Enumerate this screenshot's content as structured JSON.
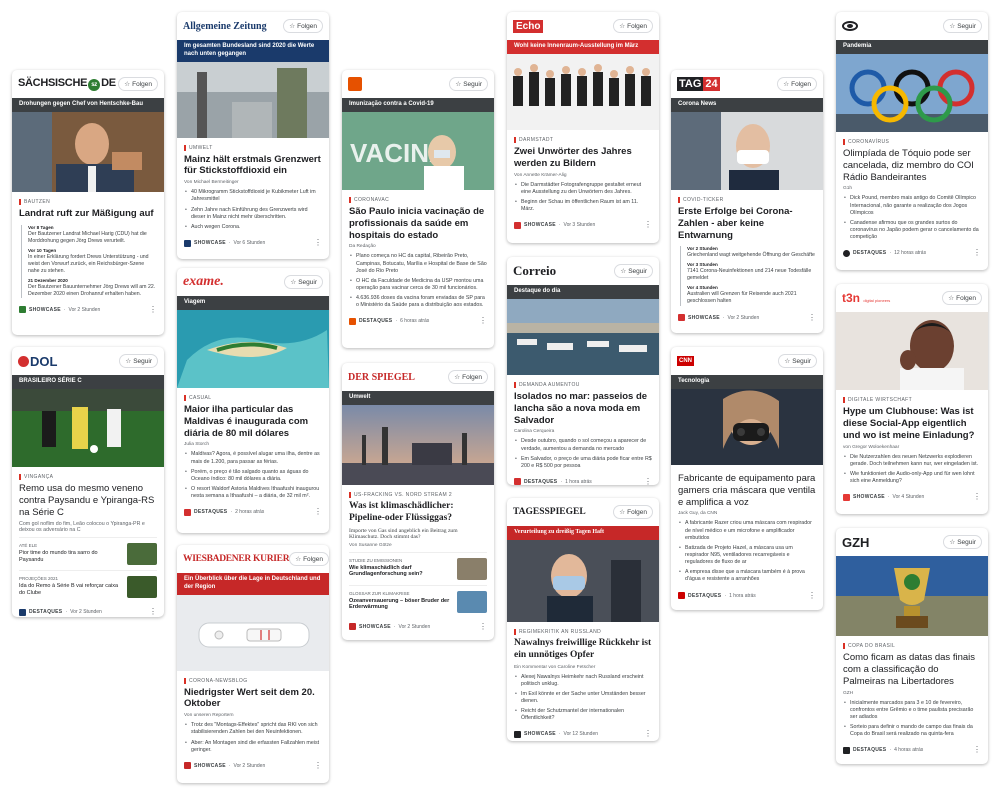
{
  "actions": {
    "follow": "Folgen",
    "seguir": "Seguir"
  },
  "cards": {
    "sz": {
      "logo": "SÄCHSISCHE",
      "logo2": "DE",
      "band": "Drohungen gegen Chef von Hentschke-Bau",
      "kicker": "BAUTZEN",
      "title": "Landrat ruft zur Mäßigung auf",
      "timeline": [
        {
          "t": "Vor 8 Tagen",
          "x": "Der Bautzener Landrat Michael Harig (CDU) hat die Morddrohung gegen Jörg Drews verurteilt."
        },
        {
          "t": "Vor 10 Tagen",
          "x": "In einer Erklärung fordert Drews Unterstützung - und weist den Vorwurf zurück, ein Reichsbürger-Szene nahe zu stehen."
        },
        {
          "t": "21 Dezember 2020",
          "x": "Der Bautzener Bauunternehmer Jörg Drews will am 22. Dezember 2020 einen Drohanruf erhalten haben."
        }
      ],
      "source": "SHOWCASE",
      "time": "Vor 2 Stunden"
    },
    "dol": {
      "logo": "DOL",
      "band": "BRASILEIRO SÉRIE C",
      "kicker": "VINGANÇA",
      "title": "Remo usa do mesmo veneno contra Paysandu e Ypiranga-RS na Série C",
      "desc": "Com gol noflim do fim, Leão colocou o Ypiranga-PR e deixou os adversário na C",
      "related": [
        {
          "k": "ATÉ ELE",
          "h": "Pior time do mundo tira sarro do Paysandu"
        },
        {
          "k": "PROJEÇÕES 2021",
          "h": "Ida do Remo à Série B vai reforçar caixa do Clube"
        }
      ],
      "source": "DESTAQUES",
      "time": "Vor 2 Stunden"
    },
    "az": {
      "logo": "Allgemeine Zeitung",
      "band": "Im gesamten Bundesland sind 2020 die Werte nach unten gegangen",
      "kicker": "UMWELT",
      "title": "Mainz hält erstmals Grenzwert für Stickstoffdioxid ein",
      "byline": "Von Michael Bermeitinger",
      "bullets": [
        "40 Mikrogramm Stickstoffdioxid je Kubikmeter Luft im Jahresmittel",
        "Zehn Jahre nach Einführung des Grenzwerts wird dieser in Mainz nicht mehr überschritten.",
        "Auch wegen Corona."
      ],
      "source": "SHOWCASE",
      "time": "Vor 6 Stunden"
    },
    "exame": {
      "logo": "exame.",
      "band": "Viagem",
      "kicker": "CASUAL",
      "title": "Maior ilha particular das Maldivas é inaugurada com diária de 80 mil dólares",
      "byline": "Julia Storch",
      "bullets": [
        "Maldivas? Agora, é possível alugar uma ilha, dentre as mais de 1.200, para passar as férias.",
        "Porém, o preço é tão salgado quanto as águas do Oceano índico: 80 mil dólares a diária.",
        "O resort Waldorf Astoria Maldives Ithaafushi inaugurou nesta semana a Ithaafushi – a diária, de 32 mil m²."
      ],
      "source": "DESTAQUES",
      "time": "2 horas atrás"
    },
    "wk": {
      "logo": "WIESBADENER KURIER",
      "band": "Ein Überblick über die Lage in Deutschland und der Region",
      "kicker": "CORONA-NEWSBLOG",
      "title": "Niedrigster Wert seit dem 20. Oktober",
      "byline": "Von unseren Reportern",
      "bullets": [
        "Trotz des \"Montags-Effektes\" spricht das RKI von sich stabilisierenden Zahlen bei den Neuinfektionen.",
        "Aber: An Montagen sind die erfassten Fallzahlen meist geringer."
      ],
      "source": "SHOWCASE",
      "time": "Vor 2 Stunden"
    },
    "estadao": {
      "band": "Imunização contra a Covid-19",
      "kicker": "CORONAVAC",
      "title": "São Paulo inicia vacinação de profissionais da saúde em hospitais do estado",
      "byline": "Da Redação",
      "bullets": [
        "Plano começa no HC da capital, Ribeirão Preto, Campinas, Botucatu, Marília e Hospital de Base de São José do Rio Preto",
        "O HC da Faculdade de Medicina da USP montou uma operação para vacinar cerca de 30 mil funcionários.",
        "4.636.936 doses da vacina foram enviadas de SP para o Ministério da Saúde para a distribuição aos estados."
      ],
      "source": "DESTAQUES",
      "time": "6 horas atrás"
    },
    "spiegel": {
      "logo": "DER SPIEGEL",
      "band": "Umwelt",
      "kicker": "US-FRACKING VS. NORD STREAM 2",
      "title": "Was ist klimaschädlicher: Pipeline-oder Flüssiggas?",
      "desc": "Importe von Gas sind angeblich ein Beitrag zum Klimaschutz. Doch stimmt das?",
      "byline": "Von Susanne Götze",
      "related": [
        {
          "k": "STUDIE ZU EMISSIONEN",
          "h": "Wie klimaschädlich darf Grundlagenforschung sein?"
        },
        {
          "k": "GLOSSAR ZUR KLIMAKRISE",
          "h": "Ozeanversauerung – böser Bruder der Erderwärmung"
        }
      ],
      "source": "SHOWCASE",
      "time": "Vor 2 Stunden"
    },
    "echo": {
      "logo": "Echo",
      "band": "Wohl keine Innenraum-Ausstellung im März",
      "kicker": "DARMSTADT",
      "title": "Zwei Unwörter des Jahres werden zu Bildern",
      "byline": "Von Annette Krämer-Alig",
      "bullets": [
        "Die Darmstädter Fotografengruppe gestaltet erneut eine Ausstellung zu den Unwörtern des Jahres.",
        "Beginn der Schau im öffentlichen Raum ist am 11. März."
      ],
      "source": "SHOWCASE",
      "time": "Vor 3 Stunden"
    },
    "correio": {
      "logo": "Correio",
      "band": "Destaque do dia",
      "kicker": "DEMANDA AUMENTOU",
      "title": "Isolados no mar: passeios de lancha são a nova moda em Salvador",
      "byline": "Carolina Cerqueira",
      "bullets": [
        "Desde outubro, quando o sol começou a aparecer de verdade, aumentou a demanda no mercado",
        "Em Salvador, o preço de uma diária pode ficar entre R$ 200 e R$ 500 por pessoa"
      ],
      "source": "DESTAQUES",
      "time": "1 hora atrás"
    },
    "tsp": {
      "logo": "TAGESSPIEGEL",
      "band": "Verurteilung zu dreißig Tagen Haft",
      "kicker": "REGIMEKRITIK AN RUSSLAND",
      "title": "Nawalnys freiwillige Rückkehr ist ein unnötiges Opfer",
      "byline": "Ein Kommentar von Caroline Fetscher",
      "bullets": [
        "Alexej Nawalnys Heimkehr nach Russland erscheint politisch unklug.",
        "Im Exil könnte er der Sache unter Umständen besser dienen.",
        "Reicht der Schutzmantel der internationalen Öffentlichkeit?"
      ],
      "source": "SHOWCASE",
      "time": "Vor 12 Stunden"
    },
    "tag24": {
      "logo": "TAG",
      "logo2": "24",
      "band": "Corona News",
      "kicker": "COVID-TICKER",
      "title": "Erste Erfolge bei Corona-Zahlen - aber keine Entwarnung",
      "timeline": [
        {
          "t": "Vor 2 Stunden",
          "x": "Griechenland wagt weitgehende Öffnung der Geschäfte"
        },
        {
          "t": "Vor 3 Stunden",
          "x": "7141 Corona-Neuinfektionen und 214 neue Todesfälle gemeldet"
        },
        {
          "t": "Vor 4 Stunden",
          "x": "Australien will Grenzen für Reisende auch 2021 geschlossen halten"
        }
      ],
      "source": "SHOWCASE",
      "time": "Vor 2 Stunden"
    },
    "cnn": {
      "logo": "CNN",
      "band": "Tecnologia",
      "title": "Fabricante de equipamento para gamers cria máscara que ventila e amplifica a voz",
      "byline": "Jack Guy, da CNN",
      "bullets": [
        "A fabricante Razer criou uma máscara com respirador de nível médico e um microfone e amplificador embutidos",
        "Batizada de Projeto Hazel, a máscara usa um respirador N95, ventiladores recarregáveis e reguladores de fluxo de ar",
        "A empresa disse que a máscara também é à prova d'água e resistente a arranhões"
      ],
      "source": "DESTAQUES",
      "time": "1 hora atrás"
    },
    "globo": {
      "band": "Pandemia",
      "kicker": "CORONAVÍRUS",
      "title": "Olimpíada de Tóquio pode ser cancelada, diz membro do COI Rádio Bandeirantes",
      "byline": "G1h",
      "bullets": [
        "Dick Pound, membro mais antigo do Comitê Olímpico Internacional, não garante a realização dos Jogos Olímpicos",
        "Canadense afirmou que os grandes surtos do coronavírus no Japão podem gerar o cancelamento da competição"
      ],
      "source": "DESTAQUES",
      "time": "12 horas atrás"
    },
    "t3n": {
      "logo": "t3n",
      "logo2": "digital pioneers",
      "kicker": "DIGITALE WIRTSCHAFT",
      "title": "Hype um Clubhouse: Was ist diese Social-App eigentlich und wo ist meine Einladung?",
      "byline": "von Gregor Woloekenhaar",
      "bullets": [
        "Die Nutzerzahlen des neuen Netzwerks explodieren gerade. Doch teilnehmen kann nur, wer eingeladen ist.",
        "Wie funktioniert die Audio-only-App und für wen lohnt sich eine Anmeldung?"
      ],
      "source": "SHOWCASE",
      "time": "Vor 4 Stunden"
    },
    "gzh": {
      "logo": "GZH",
      "kicker": "COPA DO BRASIL",
      "title": "Como ficam as datas das finais com a classificação do Palmeiras na Libertadores",
      "byline": "GZH",
      "bullets": [
        "Inicialmente marcados para 3 e 10 de fevereiro, confrontos entre Grêmio e o time paulista precisarão ser adiados",
        "Sorteio para definir o mando de campo das finais da Copa do Brasil será realizado na quinta-fera"
      ],
      "source": "DESTAQUES",
      "time": "4 horas atrás"
    }
  },
  "colors": {
    "band_dark": "#3c4043",
    "band_blue": "#1a3a6b",
    "band_red": "#c62828",
    "accent": "#d93025"
  }
}
